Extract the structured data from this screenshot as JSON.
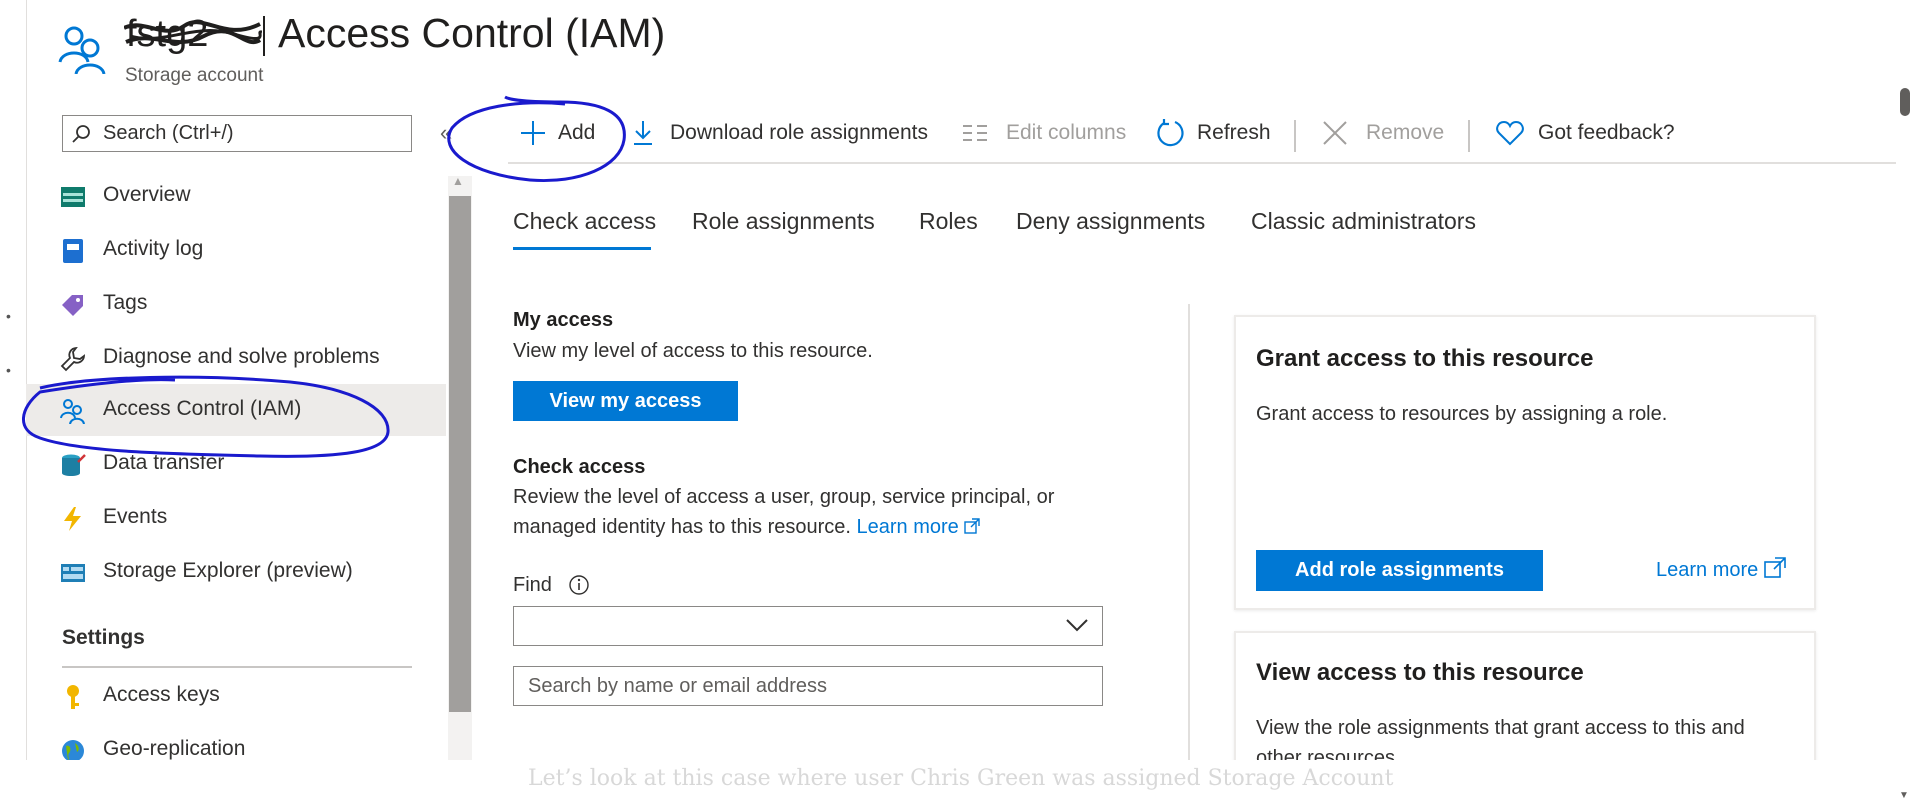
{
  "header": {
    "resource_name_redacted": "fstg2",
    "title": "Access Control (IAM)",
    "subtitle": "Storage account"
  },
  "search": {
    "placeholder": "Search (Ctrl+/)"
  },
  "collapse_glyph": "«",
  "sidebar": {
    "items": [
      {
        "label": "Overview",
        "icon": "overview-icon"
      },
      {
        "label": "Activity log",
        "icon": "activity-log-icon"
      },
      {
        "label": "Tags",
        "icon": "tag-icon"
      },
      {
        "label": "Diagnose and solve problems",
        "icon": "wrench-icon"
      },
      {
        "label": "Access Control (IAM)",
        "icon": "people-icon",
        "selected": true
      },
      {
        "label": "Data transfer",
        "icon": "data-transfer-icon"
      },
      {
        "label": "Events",
        "icon": "lightning-icon"
      },
      {
        "label": "Storage Explorer (preview)",
        "icon": "storage-explorer-icon"
      }
    ],
    "section_settings": "Settings",
    "settings_items": [
      {
        "label": "Access keys",
        "icon": "key-icon"
      },
      {
        "label": "Geo-replication",
        "icon": "globe-icon"
      }
    ]
  },
  "toolbar": {
    "add": "Add",
    "download": "Download role assignments",
    "edit_columns": "Edit columns",
    "refresh": "Refresh",
    "remove": "Remove",
    "feedback": "Got feedback?"
  },
  "tabs": [
    "Check access",
    "Role assignments",
    "Roles",
    "Deny assignments",
    "Classic administrators"
  ],
  "active_tab": "Check access",
  "my_access": {
    "heading": "My access",
    "description": "View my level of access to this resource.",
    "button": "View my access"
  },
  "check_access": {
    "heading": "Check access",
    "description_line1": "Review the level of access a user, group, service principal, or",
    "description_line2": "managed identity has to this resource.",
    "learn_more": "Learn more",
    "find_label": "Find",
    "find_select_value": "",
    "search_placeholder": "Search by name or email address"
  },
  "grant_card": {
    "title": "Grant access to this resource",
    "description": "Grant access to resources by assigning a role.",
    "button": "Add role assignments",
    "learn_more": "Learn more"
  },
  "view_card": {
    "title": "View access to this resource",
    "description_line1": "View the role assignments that grant access to this and",
    "description_line2": "other resources."
  },
  "caption": "Let’s look at this case where user Chris Green was assigned Storage Account",
  "colors": {
    "accent": "#0078d4",
    "annotation_ink": "#1a1acd",
    "selected_bg": "#edebe9"
  }
}
